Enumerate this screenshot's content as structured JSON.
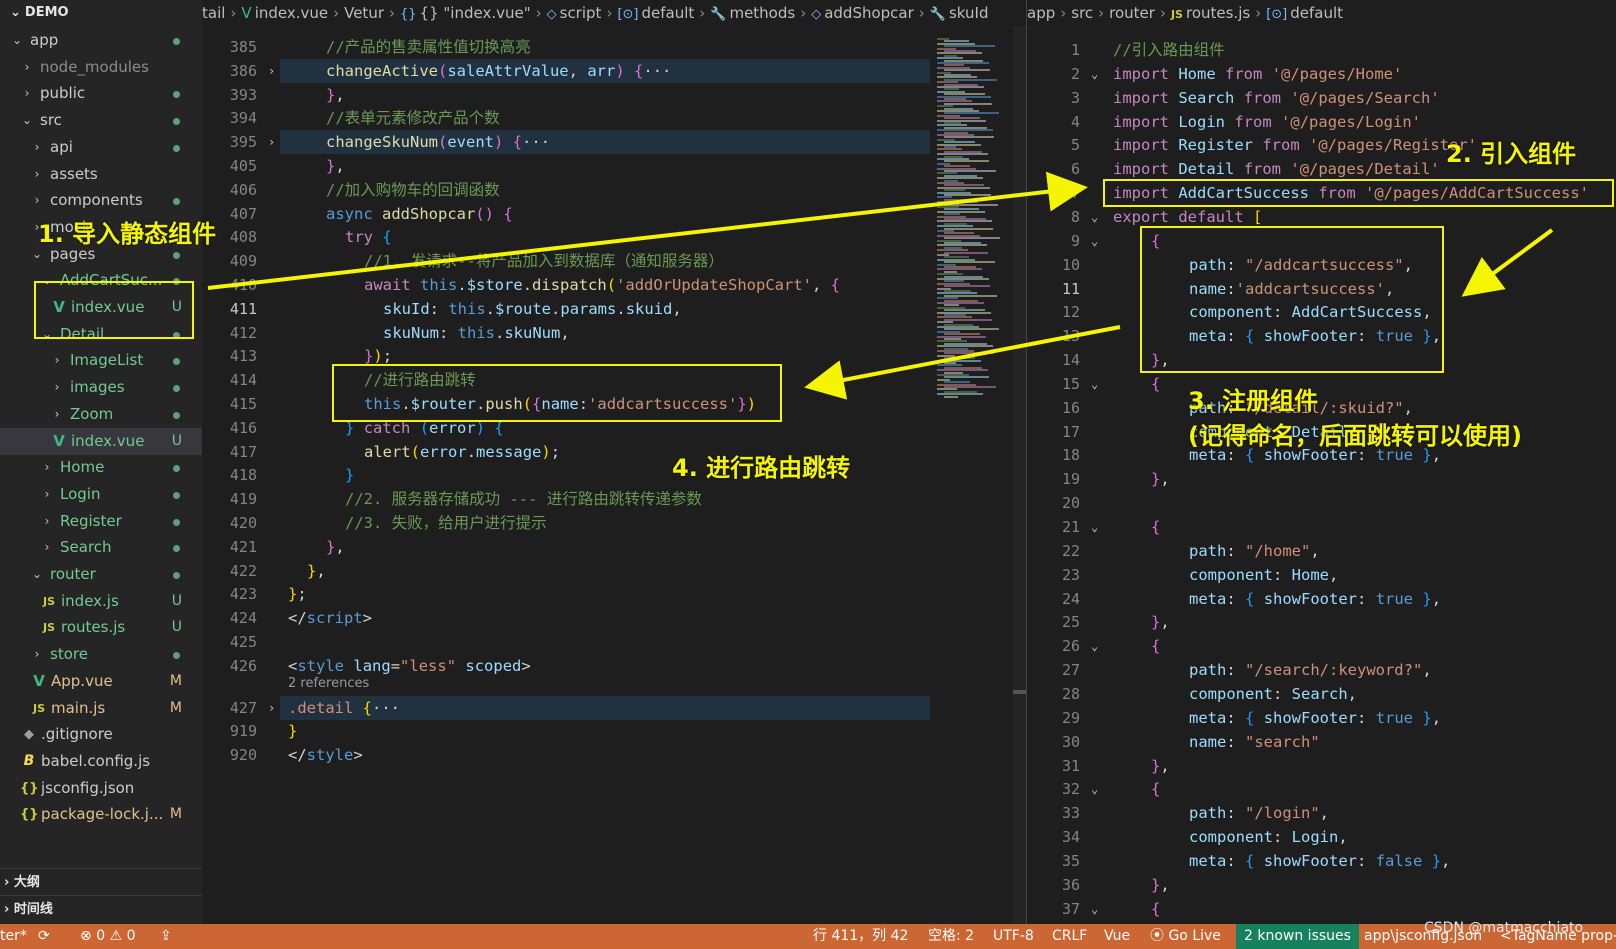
{
  "sidebar": {
    "title": "DEMO",
    "items": [
      {
        "label": "app",
        "depth": 0,
        "chev": "open",
        "status": "dot",
        "status_color": "#73c991"
      },
      {
        "label": "node_modules",
        "depth": 1,
        "chev": "closed",
        "status": "",
        "muted": true
      },
      {
        "label": "public",
        "depth": 1,
        "chev": "closed",
        "status": "dot",
        "status_color": "#73c991"
      },
      {
        "label": "src",
        "depth": 1,
        "chev": "open",
        "status": "dot",
        "status_color": "#73c991"
      },
      {
        "label": "api",
        "depth": 2,
        "chev": "closed",
        "status": "dot",
        "status_color": "#73c991"
      },
      {
        "label": "assets",
        "depth": 2,
        "chev": "closed",
        "status": ""
      },
      {
        "label": "components",
        "depth": 2,
        "chev": "closed",
        "status": "dot",
        "status_color": "#73c991"
      },
      {
        "label": "mock",
        "depth": 2,
        "chev": "closed",
        "status": ""
      },
      {
        "label": "pages",
        "depth": 2,
        "chev": "open",
        "status": "dot",
        "status_color": "#73c991"
      },
      {
        "label": "AddCartSuc...",
        "depth": 3,
        "chev": "open",
        "status": "dot",
        "status_color": "#73c991",
        "color": "#73c991"
      },
      {
        "label": "index.vue",
        "depth": 4,
        "icon": "vue",
        "status": "U",
        "status_color": "#73c991",
        "color": "#73c991"
      },
      {
        "label": "Detail",
        "depth": 3,
        "chev": "open",
        "status": "dot",
        "status_color": "#73c991",
        "color": "#73c991"
      },
      {
        "label": "ImageList",
        "depth": 4,
        "chev": "closed",
        "status": "dot",
        "status_color": "#73c991",
        "color": "#73c991"
      },
      {
        "label": "images",
        "depth": 4,
        "chev": "closed",
        "status": "dot",
        "status_color": "#73c991",
        "color": "#73c991"
      },
      {
        "label": "Zoom",
        "depth": 4,
        "chev": "closed",
        "status": "dot",
        "status_color": "#73c991",
        "color": "#73c991"
      },
      {
        "label": "index.vue",
        "depth": 4,
        "icon": "vue",
        "status": "U",
        "status_color": "#73c991",
        "color": "#73c991",
        "active": true
      },
      {
        "label": "Home",
        "depth": 3,
        "chev": "closed",
        "status": "dot",
        "status_color": "#73c991",
        "color": "#73c991"
      },
      {
        "label": "Login",
        "depth": 3,
        "chev": "closed",
        "status": "dot",
        "status_color": "#73c991",
        "color": "#73c991"
      },
      {
        "label": "Register",
        "depth": 3,
        "chev": "closed",
        "status": "dot",
        "status_color": "#73c991",
        "color": "#73c991"
      },
      {
        "label": "Search",
        "depth": 3,
        "chev": "closed",
        "status": "dot",
        "status_color": "#73c991",
        "color": "#73c991"
      },
      {
        "label": "router",
        "depth": 2,
        "chev": "open",
        "status": "dot",
        "status_color": "#73c991",
        "color": "#73c991"
      },
      {
        "label": "index.js",
        "depth": 3,
        "icon": "js",
        "status": "U",
        "status_color": "#73c991",
        "color": "#73c991"
      },
      {
        "label": "routes.js",
        "depth": 3,
        "icon": "js",
        "status": "U",
        "status_color": "#73c991",
        "color": "#73c991"
      },
      {
        "label": "store",
        "depth": 2,
        "chev": "closed",
        "status": "dot",
        "status_color": "#73c991",
        "color": "#73c991"
      },
      {
        "label": "App.vue",
        "depth": 2,
        "icon": "vue",
        "status": "M",
        "status_color": "#e2c08d",
        "color": "#e2c08d"
      },
      {
        "label": "main.js",
        "depth": 2,
        "icon": "js",
        "status": "M",
        "status_color": "#e2c08d",
        "color": "#e2c08d"
      },
      {
        "label": ".gitignore",
        "depth": 1,
        "icon": "git",
        "status": ""
      },
      {
        "label": "babel.config.js",
        "depth": 1,
        "icon": "babel",
        "status": ""
      },
      {
        "label": "jsconfig.json",
        "depth": 1,
        "icon": "json",
        "status": ""
      },
      {
        "label": "package-lock.j...",
        "depth": 1,
        "icon": "json",
        "status": "M",
        "status_color": "#e2c08d",
        "color": "#e2c08d"
      }
    ],
    "outline_label": "大纲",
    "timeline_label": "时间线"
  },
  "left_editor": {
    "breadcrumb": [
      "tail",
      "index.vue",
      "Vetur",
      "{} \"index.vue\"",
      "script",
      "default",
      "methods",
      "addShopcar",
      "skuId"
    ],
    "references_label": "2 references",
    "lines": [
      {
        "n": "385",
        "html": "<span class='cmt'>//产品的售卖属性值切换高亮</span>",
        "indent": 2
      },
      {
        "n": "386",
        "fold": "closed",
        "hl": true,
        "html": "<span class='fn'>changeActive</span><span class='brk2'>(</span><span class='var'>saleAttrValue</span><span class='punc'>, </span><span class='var'>arr</span><span class='brk2'>)</span> <span class='brk2'>{</span><span class='punc'>···</span>",
        "indent": 2
      },
      {
        "n": "393",
        "html": "<span class='brk2'>}</span><span class='punc'>,</span>",
        "indent": 2
      },
      {
        "n": "394",
        "html": "<span class='cmt'>//表单元素修改产品个数</span>",
        "indent": 2
      },
      {
        "n": "395",
        "fold": "closed",
        "hl": true,
        "html": "<span class='fn'>changeSkuNum</span><span class='brk2'>(</span><span class='var'>event</span><span class='brk2'>)</span> <span class='brk2'>{</span><span class='punc'>···</span>",
        "indent": 2
      },
      {
        "n": "405",
        "html": "<span class='brk2'>}</span><span class='punc'>,</span>",
        "indent": 2
      },
      {
        "n": "406",
        "html": "<span class='cmt'>//加入购物车的回调函数</span>",
        "indent": 2
      },
      {
        "n": "407",
        "html": "<span class='kw'>async</span> <span class='fn'>addShopcar</span><span class='brk2'>()</span> <span class='brk2'>{</span>",
        "indent": 2
      },
      {
        "n": "408",
        "html": "<span class='kw2'>try</span> <span class='brk3'>{</span>",
        "indent": 3
      },
      {
        "n": "409",
        "html": "<span class='cmt'>//1. 发请求--将产品加入到数据库（通知服务器）</span>",
        "indent": 4
      },
      {
        "n": "410",
        "html": "<span class='kw2'>await</span> <span class='kw'>this</span><span class='punc'>.</span><span class='var'>$store</span><span class='punc'>.</span><span class='fn'>dispatch</span><span class='brk'>(</span><span class='str'>'addOrUpdateShopCart'</span><span class='punc'>, </span><span class='brk2'>{</span>",
        "indent": 4
      },
      {
        "n": "411",
        "cur": true,
        "html": "<span class='prop'>skuId</span><span class='punc'>: </span><span class='kw'>this</span><span class='punc'>.</span><span class='var'>$route</span><span class='punc'>.</span><span class='var'>params</span><span class='punc'>.</span><span class='var'>skuid</span><span class='punc'>,</span>",
        "indent": 5
      },
      {
        "n": "412",
        "html": "<span class='prop'>skuNum</span><span class='punc'>: </span><span class='kw'>this</span><span class='punc'>.</span><span class='var'>skuNum</span><span class='punc'>,</span>",
        "indent": 5
      },
      {
        "n": "413",
        "html": "<span class='brk2'>}</span><span class='brk'>)</span><span class='punc'>;</span>",
        "indent": 4
      },
      {
        "n": "414",
        "html": "<span class='cmt'>//进行路由跳转</span>",
        "indent": 4
      },
      {
        "n": "415",
        "html": "<span class='kw'>this</span><span class='punc'>.</span><span class='var'>$router</span><span class='punc'>.</span><span class='fn'>push</span><span class='brk'>(</span><span class='brk2'>{</span><span class='prop'>name</span><span class='punc'>:</span><span class='str'>'addcartsuccess'</span><span class='brk2'>}</span><span class='brk'>)</span>",
        "indent": 4
      },
      {
        "n": "416",
        "html": "<span class='brk3'>}</span> <span class='kw2'>catch</span> <span class='brk3'>(</span><span class='var'>error</span><span class='brk3'>)</span> <span class='brk3'>{</span>",
        "indent": 3
      },
      {
        "n": "417",
        "html": "<span class='fn'>alert</span><span class='brk'>(</span><span class='var'>error</span><span class='punc'>.</span><span class='var'>message</span><span class='brk'>)</span><span class='punc'>;</span>",
        "indent": 4
      },
      {
        "n": "418",
        "html": "<span class='brk3'>}</span>",
        "indent": 3
      },
      {
        "n": "419",
        "html": "<span class='cmt'>//2. 服务器存储成功 --- 进行路由跳转传递参数</span>",
        "indent": 3
      },
      {
        "n": "420",
        "html": "<span class='cmt'>//3. 失败，给用户进行提示</span>",
        "indent": 3
      },
      {
        "n": "421",
        "html": "<span class='brk2'>}</span><span class='punc'>,</span>",
        "indent": 2
      },
      {
        "n": "422",
        "html": "<span class='brk'>}</span><span class='punc'>,</span>",
        "indent": 1
      },
      {
        "n": "423",
        "html": "<span class='brk'>}</span><span class='punc'>;</span>",
        "indent": 0
      },
      {
        "n": "424",
        "html": "<span class='punc'>&lt;/</span><span class='tag'>script</span><span class='punc'>&gt;</span>",
        "indent": 0
      },
      {
        "n": "425",
        "html": "",
        "indent": 0
      },
      {
        "n": "426",
        "html": "<span class='punc'>&lt;</span><span class='tag'>style</span> <span class='attr'>lang</span><span class='punc'>=</span><span class='str'>\"less\"</span> <span class='attr'>scoped</span><span class='punc'>&gt;</span>",
        "indent": 0
      },
      {
        "n": "427",
        "fold": "closed",
        "hl": true,
        "refs": true,
        "html": "<span class='str'>.detail</span> <span class='brk'>{</span><span class='punc'>···</span>",
        "indent": 0
      },
      {
        "n": "919",
        "html": "<span class='brk'>}</span>",
        "indent": 0
      },
      {
        "n": "920",
        "html": "<span class='punc'>&lt;/</span><span class='tag'>style</span><span class='punc'>&gt;</span>",
        "indent": 0
      }
    ]
  },
  "right_editor": {
    "breadcrumb": [
      "app",
      "src",
      "router",
      "routes.js",
      "default"
    ],
    "lines": [
      {
        "n": "1",
        "html": "<span class='cmt'>//引入路由组件</span>",
        "indent": 0
      },
      {
        "n": "2",
        "fold": "open",
        "html": "<span class='kw2'>import</span> <span class='var'>Home</span> <span class='kw2'>from</span> <span class='str'>'@/pages/Home'</span>",
        "indent": 0
      },
      {
        "n": "3",
        "html": "<span class='kw2'>import</span> <span class='var'>Search</span> <span class='kw2'>from</span> <span class='str'>'@/pages/Search'</span>",
        "indent": 0
      },
      {
        "n": "4",
        "html": "<span class='kw2'>import</span> <span class='var'>Login</span> <span class='kw2'>from</span> <span class='str'>'@/pages/Login'</span>",
        "indent": 0
      },
      {
        "n": "5",
        "html": "<span class='kw2'>import</span> <span class='var'>Register</span> <span class='kw2'>from</span> <span class='str'>'@/pages/Register'</span>",
        "indent": 0
      },
      {
        "n": "6",
        "html": "<span class='kw2'>import</span> <span class='var'>Detail</span> <span class='kw2'>from</span> <span class='str'>'@/pages/Detail'</span>",
        "indent": 0
      },
      {
        "n": "7",
        "html": "<span class='kw2'>import</span> <span class='var'>AddCartSuccess</span> <span class='kw2'>from</span> <span class='str'>'@/pages/AddCartSuccess'</span>",
        "indent": 0
      },
      {
        "n": "8",
        "fold": "open",
        "html": "<span class='kw2'>export</span> <span class='kw2'>default</span> <span class='brk'>[</span>",
        "indent": 0
      },
      {
        "n": "9",
        "fold": "open",
        "html": "<span class='brk2'>{</span>",
        "indent": 1
      },
      {
        "n": "10",
        "html": "<span class='prop'>path</span><span class='punc'>: </span><span class='str'>\"/addcartsuccess\"</span><span class='punc'>,</span>",
        "indent": 2
      },
      {
        "n": "11",
        "cur": true,
        "html": "<span class='prop'>name</span><span class='punc'>:</span><span class='str'>'addcartsuccess'</span><span class='punc'>,</span>",
        "indent": 2
      },
      {
        "n": "12",
        "html": "<span class='prop'>component</span><span class='punc'>: </span><span class='var'>AddCartSuccess</span><span class='punc'>,</span>",
        "indent": 2
      },
      {
        "n": "13",
        "html": "<span class='prop'>meta</span><span class='punc'>: </span><span class='brk3'>{</span> <span class='prop'>showFooter</span><span class='punc'>: </span><span class='kw'>true</span> <span class='brk3'>}</span><span class='punc'>,</span>",
        "indent": 2
      },
      {
        "n": "14",
        "html": "<span class='brk2'>}</span><span class='punc'>,</span>",
        "indent": 1
      },
      {
        "n": "15",
        "fold": "open",
        "html": "<span class='brk2'>{</span>",
        "indent": 1
      },
      {
        "n": "16",
        "html": "<span class='prop'>path</span><span class='punc'>: </span><span class='str'>\"/detail/:skuid?\"</span><span class='punc'>,</span>",
        "indent": 2
      },
      {
        "n": "17",
        "html": "<span class='prop'>component</span><span class='punc'>: </span><span class='var'>Detail</span><span class='punc'>,</span>",
        "indent": 2
      },
      {
        "n": "18",
        "html": "<span class='prop'>meta</span><span class='punc'>: </span><span class='brk3'>{</span> <span class='prop'>showFooter</span><span class='punc'>: </span><span class='kw'>true</span> <span class='brk3'>}</span><span class='punc'>,</span>",
        "indent": 2
      },
      {
        "n": "19",
        "html": "<span class='brk2'>}</span><span class='punc'>,</span>",
        "indent": 1
      },
      {
        "n": "20",
        "html": "",
        "indent": 0
      },
      {
        "n": "21",
        "fold": "open",
        "html": "<span class='brk2'>{</span>",
        "indent": 1
      },
      {
        "n": "22",
        "html": "<span class='prop'>path</span><span class='punc'>: </span><span class='str'>\"/home\"</span><span class='punc'>,</span>",
        "indent": 2
      },
      {
        "n": "23",
        "html": "<span class='prop'>component</span><span class='punc'>: </span><span class='var'>Home</span><span class='punc'>,</span>",
        "indent": 2
      },
      {
        "n": "24",
        "html": "<span class='prop'>meta</span><span class='punc'>: </span><span class='brk3'>{</span> <span class='prop'>showFooter</span><span class='punc'>: </span><span class='kw'>true</span> <span class='brk3'>}</span><span class='punc'>,</span>",
        "indent": 2
      },
      {
        "n": "25",
        "html": "<span class='brk2'>}</span><span class='punc'>,</span>",
        "indent": 1
      },
      {
        "n": "26",
        "fold": "open",
        "html": "<span class='brk2'>{</span>",
        "indent": 1
      },
      {
        "n": "27",
        "html": "<span class='prop'>path</span><span class='punc'>: </span><span class='str'>\"/search/:keyword?\"</span><span class='punc'>,</span>",
        "indent": 2
      },
      {
        "n": "28",
        "html": "<span class='prop'>component</span><span class='punc'>: </span><span class='var'>Search</span><span class='punc'>,</span>",
        "indent": 2
      },
      {
        "n": "29",
        "html": "<span class='prop'>meta</span><span class='punc'>: </span><span class='brk3'>{</span> <span class='prop'>showFooter</span><span class='punc'>: </span><span class='kw'>true</span> <span class='brk3'>}</span><span class='punc'>,</span>",
        "indent": 2
      },
      {
        "n": "30",
        "html": "<span class='prop'>name</span><span class='punc'>: </span><span class='str'>\"search\"</span>",
        "indent": 2
      },
      {
        "n": "31",
        "html": "<span class='brk2'>}</span><span class='punc'>,</span>",
        "indent": 1
      },
      {
        "n": "32",
        "fold": "open",
        "html": "<span class='brk2'>{</span>",
        "indent": 1
      },
      {
        "n": "33",
        "html": "<span class='prop'>path</span><span class='punc'>: </span><span class='str'>\"/login\"</span><span class='punc'>,</span>",
        "indent": 2
      },
      {
        "n": "34",
        "html": "<span class='prop'>component</span><span class='punc'>: </span><span class='var'>Login</span><span class='punc'>,</span>",
        "indent": 2
      },
      {
        "n": "35",
        "html": "<span class='prop'>meta</span><span class='punc'>: </span><span class='brk3'>{</span> <span class='prop'>showFooter</span><span class='punc'>: </span><span class='kw'>false</span> <span class='brk3'>}</span><span class='punc'>,</span>",
        "indent": 2
      },
      {
        "n": "36",
        "html": "<span class='brk2'>}</span><span class='punc'>,</span>",
        "indent": 1
      },
      {
        "n": "37",
        "fold": "open",
        "html": "<span class='brk2'>{</span>",
        "indent": 1
      }
    ]
  },
  "annotations": {
    "step1": "1. 导入静态组件",
    "step2": "2. 引入组件",
    "step3_line1": "3. 注册组件",
    "step3_line2": "(记得命名，后面跳转可以使用)",
    "step4": "4. 进行路由跳转",
    "color": "#f5f500"
  },
  "statusbar": {
    "branch": "ter*",
    "errors": "0",
    "warnings": "0",
    "position": "行 411，列 42",
    "spaces": "空格: 2",
    "encoding": "UTF-8",
    "eol": "CRLF",
    "language": "Vue",
    "go_live": "Go Live",
    "known_issues": "2 known issues",
    "config": "app\\jsconfig.json",
    "tagname": "<TagName prop-",
    "watermark": "CSDN @matmacchiato",
    "background": "#cc6633"
  }
}
